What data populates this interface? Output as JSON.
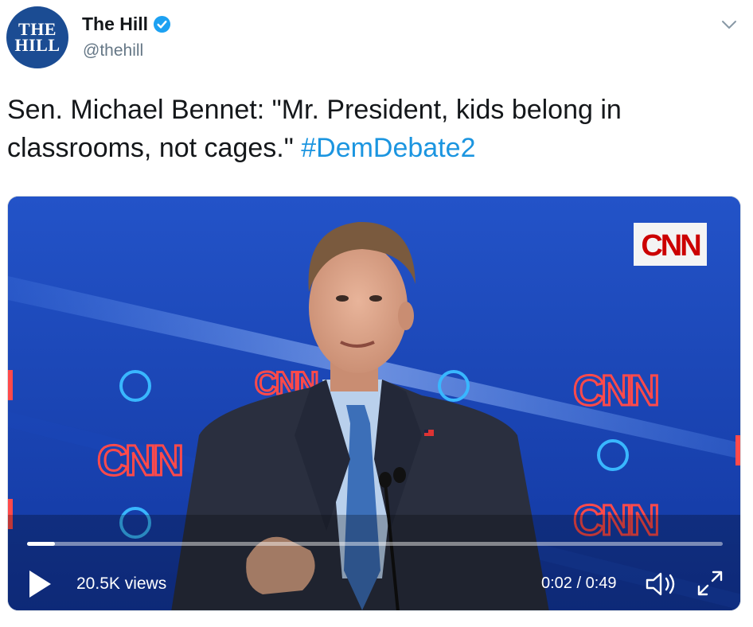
{
  "author": {
    "avatar_line1": "THE",
    "avatar_line2": "HILL",
    "display_name": "The Hill",
    "handle": "@thehill",
    "verified": true
  },
  "tweet": {
    "text": "Sen. Michael Bennet: \"Mr. President, kids belong in classrooms, not cages.\"",
    "hashtag": "#DemDebate2"
  },
  "video": {
    "overlay_logo": "CNN",
    "background_logos": [
      "CNN",
      "CNN",
      "CNN",
      "CNN"
    ],
    "progress": 0.04,
    "views": "20.5K views",
    "time": "0:02 / 0:49"
  },
  "colors": {
    "accent": "#1b95e0",
    "avatar_bg": "#1b4c93",
    "verified": "#1da1f2",
    "cnn_red": "#cc0000"
  }
}
